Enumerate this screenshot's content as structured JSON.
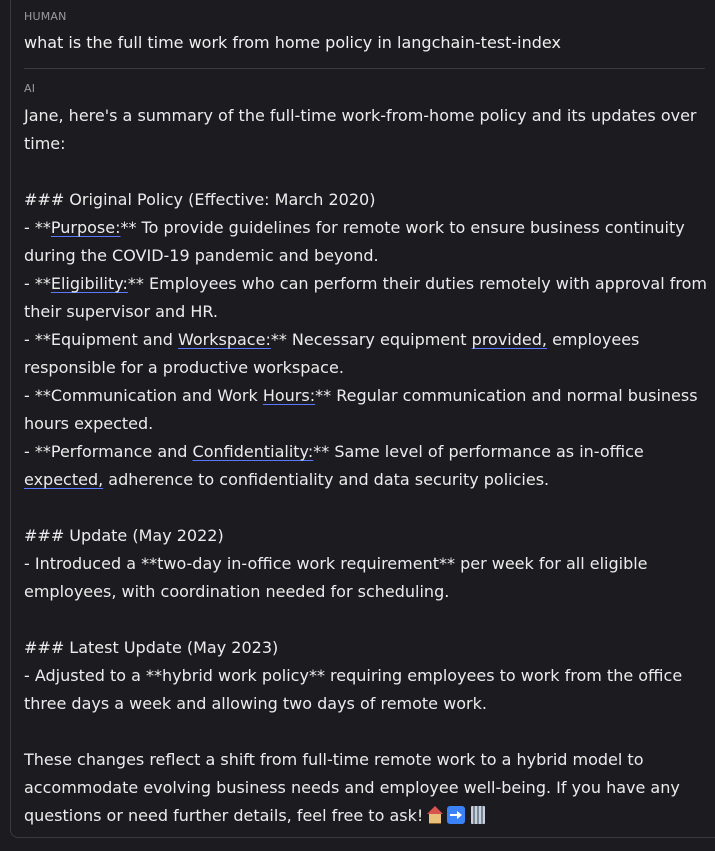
{
  "human": {
    "label": "HUMAN",
    "message": "what is the full time work from home policy in langchain-test-index"
  },
  "ai": {
    "label": "AI",
    "lines": {
      "l1": "Jane, here's a summary of the full-time work-from-home policy and its updates over",
      "l2": "time:",
      "l4": "### Original Policy (Effective: March 2020)",
      "l5a": "- **",
      "l5u": "Purpose:",
      "l5b": "** To provide guidelines for remote work to ensure business continuity",
      "l6": "during the COVID-19 pandemic and beyond.",
      "l7a": "- **",
      "l7u": "Eligibility:",
      "l7b": "** Employees who can perform their duties remotely with approval from",
      "l8": "their supervisor and HR.",
      "l9a": "- **Equipment and ",
      "l9u": "Workspace:",
      "l9b": "** Necessary equipment ",
      "l9u2": "provided,",
      "l9c": " employees",
      "l10": "responsible for a productive workspace.",
      "l11a": "- **Communication and Work ",
      "l11u": "Hours:",
      "l11b": "** Regular communication and normal business",
      "l12": "hours expected.",
      "l13a": "- **Performance and ",
      "l13u": "Confidentiality:",
      "l13b": "** Same level of performance as in-office",
      "l14u": "expected,",
      "l14b": " adherence to confidentiality and data security policies.",
      "l16": "### Update (May 2022)",
      "l17": "- Introduced a **two-day in-office work requirement** per week for all eligible",
      "l18": "employees, with coordination needed for scheduling.",
      "l20": "### Latest Update (May 2023)",
      "l21": "- Adjusted to a **hybrid work policy** requiring employees to work from the office",
      "l22": "three days a week and allowing two days of remote work.",
      "l24": "These changes reflect a shift from full-time remote work to a hybrid model to",
      "l25": "accommodate evolving business needs and employee well-being. If you have any",
      "l26": "questions or need further details, feel free to ask!"
    },
    "emojis": [
      "house-icon",
      "right-arrow-icon",
      "office-building-icon"
    ]
  }
}
